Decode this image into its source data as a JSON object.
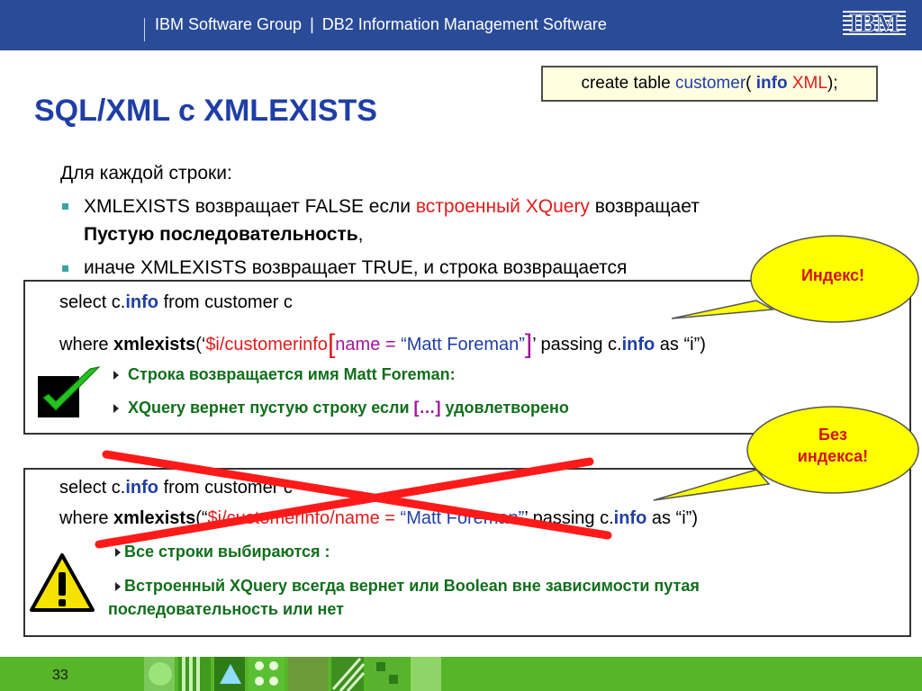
{
  "header": {
    "group": "IBM Software Group",
    "divider": "|",
    "division": "DB2 Information Management Software",
    "logo_text": "IBM",
    "logo_icon": "ibm-logo-icon"
  },
  "create_table": {
    "prefix": "create table ",
    "table": "customer",
    "open": "( ",
    "column": "info",
    "space": " ",
    "type": "XML",
    "close": ");"
  },
  "title": "SQL/XML с XMLEXISTS",
  "intro": "Для каждой строки:",
  "bullets": {
    "b1_part1": "XMLEXISTS возвращает FALSE если ",
    "b1_red": "встроенный XQuery",
    "b1_part2": " возвращает",
    "b1_line2_bold": "Пустую последовательность",
    "b1_line2_end": ",",
    "b2": "иначе XMLEXISTS возвращает TRUE, и строка возвращается"
  },
  "box1": {
    "line1_a": "select c.",
    "line1_info": "info",
    "line1_b": "  from customer c",
    "line2_a": "where ",
    "line2_func": "xmlexists",
    "line2_open": "(‘",
    "line2_path": "$i/customerinfo",
    "line2_lbr": "[",
    "line2_pred": "name = ",
    "line2_value": "“Matt Foreman”",
    "line2_rbr": "]",
    "line2_b": "’ passing c.",
    "line2_info": "info",
    "line2_c": " as “i”)",
    "sub1": "Строка возвращается имя Matt Foreman:",
    "sub2_a": "XQuery вернет пустую строку  если ",
    "sub2_br": "[…]",
    "sub2_b": " удовлетворено",
    "icon": "checkmark-icon"
  },
  "box2": {
    "line1_a": "select c.",
    "line1_info": "info",
    "line1_b": "  from customer c",
    "line2_a": "where ",
    "line2_func": "xmlexists",
    "line2_open": "(“",
    "line2_path": "$i/customerinfo/name = ",
    "line2_value": "“Matt Foreman”",
    "line2_b": "’ passing c.",
    "line2_info": "info",
    "line2_c": " as “i”)",
    "sub1": "Все строки выбираются :",
    "sub2_line1": "Встроенный XQuery всегда вернет или Boolean вне зависимости путая",
    "sub2_line2": "последовательность или нет",
    "icon": "warning-icon"
  },
  "callout1": "Индекс!",
  "callout2_line1": "Без",
  "callout2_line2": "индекса!",
  "footer": {
    "page_number": "33"
  },
  "colors": {
    "header_bg": "#2a4b97",
    "title_blue": "#1f3ea6",
    "highlight_red": "#e01b1b",
    "sub_green": "#116f1c",
    "callout_yellow": "#ffff00",
    "footer_green": "#56b528"
  }
}
